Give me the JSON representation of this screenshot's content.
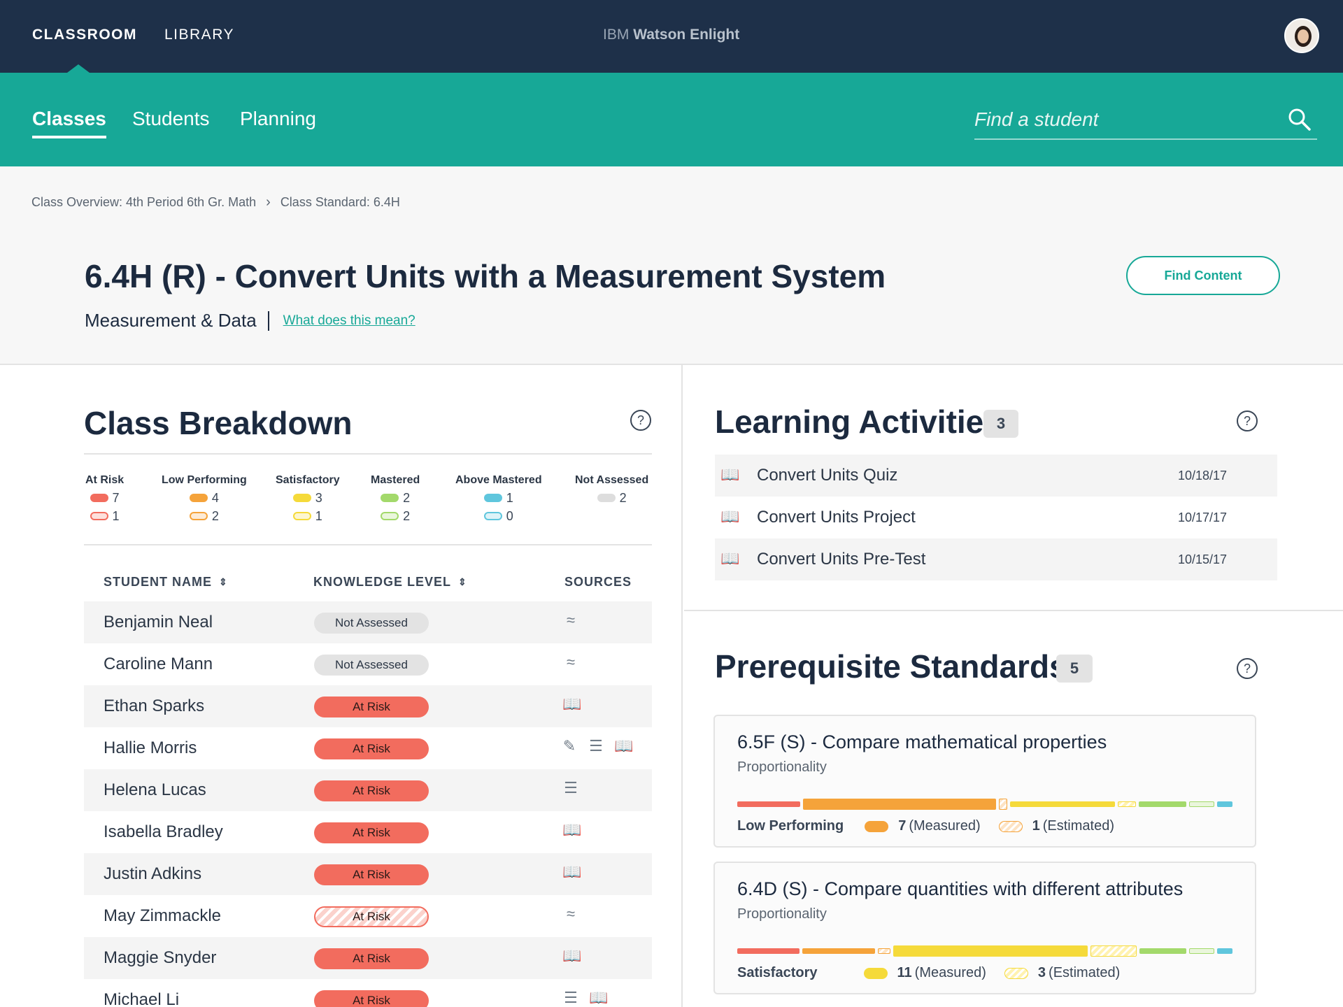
{
  "topbar": {
    "classroom": "CLASSROOM",
    "library": "LIBRARY",
    "brand_prefix": "IBM",
    "brand_name": "Watson Enlight"
  },
  "subnav": {
    "tabs": [
      {
        "label": "Classes",
        "active": true
      },
      {
        "label": "Students",
        "active": false
      },
      {
        "label": "Planning",
        "active": false
      }
    ],
    "search_placeholder": "Find a student"
  },
  "breadcrumb": {
    "items": [
      "Class Overview: 4th Period 6th Gr. Math",
      "Class Standard: 6.4H"
    ]
  },
  "header": {
    "title": "6.4H (R) - Convert Units with a Measurement System",
    "category": "Measurement & Data",
    "help_link": "What does this mean?",
    "find_content": "Find Content"
  },
  "class_breakdown": {
    "title": "Class Breakdown",
    "help": "?",
    "summary": [
      {
        "label": "At Risk",
        "measured": "7",
        "estimated": "1",
        "color": "#f26c5e",
        "light": "#fde0dc"
      },
      {
        "label": "Low Performing",
        "measured": "4",
        "estimated": "2",
        "color": "#f5a33a",
        "light": "#fdebd6"
      },
      {
        "label": "Satisfactory",
        "measured": "3",
        "estimated": "1",
        "color": "#f5da3a",
        "light": "#fdf6d0"
      },
      {
        "label": "Mastered",
        "measured": "2",
        "estimated": "2",
        "color": "#a3d96b",
        "light": "#eaf6dc"
      },
      {
        "label": "Above Mastered",
        "measured": "1",
        "estimated": "0",
        "color": "#5fc6dd",
        "light": "#def3f8"
      },
      {
        "label": "Not Assessed",
        "measured": "2",
        "color": "#dddddd"
      }
    ],
    "headers": {
      "name": "STUDENT NAME",
      "level": "KNOWLEDGE LEVEL",
      "sources": "SOURCES"
    },
    "students": [
      {
        "name": "Benjamin Neal",
        "level": "Not Assessed",
        "sources": [
          "≈"
        ]
      },
      {
        "name": "Caroline Mann",
        "level": "Not Assessed",
        "sources": [
          "≈"
        ]
      },
      {
        "name": "Ethan Sparks",
        "level": "At Risk",
        "sources": [
          "📖"
        ]
      },
      {
        "name": "Hallie Morris",
        "level": "At Risk",
        "sources": [
          "✎",
          "☰",
          "📖"
        ]
      },
      {
        "name": "Helena Lucas",
        "level": "At Risk",
        "sources": [
          "☰"
        ]
      },
      {
        "name": "Isabella Bradley",
        "level": "At Risk",
        "sources": [
          "📖"
        ]
      },
      {
        "name": "Justin Adkins",
        "level": "At Risk",
        "sources": [
          "📖"
        ]
      },
      {
        "name": "May Zimmackle",
        "level": "At Risk",
        "sources": [
          "≈"
        ]
      },
      {
        "name": "Maggie Snyder",
        "level": "At Risk",
        "sources": [
          "📖"
        ]
      },
      {
        "name": "Michael Li",
        "level": "At Risk",
        "sources": [
          "☰",
          "📖"
        ]
      }
    ]
  },
  "learning_activities": {
    "title": "Learning Activities",
    "count": "3",
    "help": "?",
    "items": [
      {
        "name": "Convert Units Quiz",
        "date": "10/18/17"
      },
      {
        "name": "Convert Units Project",
        "date": "10/17/17"
      },
      {
        "name": "Convert Units Pre-Test",
        "date": "10/15/17"
      }
    ]
  },
  "prerequisite_standards": {
    "title": "Prerequisite Standards",
    "count": "5",
    "help": "?",
    "cards": [
      {
        "title": "6.5F (S)  - Compare mathematical properties",
        "subtitle": "Proportionality",
        "level": "Low Performing",
        "measured_count": "7",
        "measured_label": "(Measured)",
        "estimated_count": "1",
        "estimated_label": "(Estimated)",
        "color": "#f5a33a"
      },
      {
        "title": "6.4D (S) - Compare quantities with different attributes",
        "subtitle": "Proportionality",
        "level": "Satisfactory",
        "measured_count": "11",
        "measured_label": "(Measured)",
        "estimated_count": "3",
        "estimated_label": "(Estimated)",
        "color": "#f5da3a"
      }
    ]
  }
}
